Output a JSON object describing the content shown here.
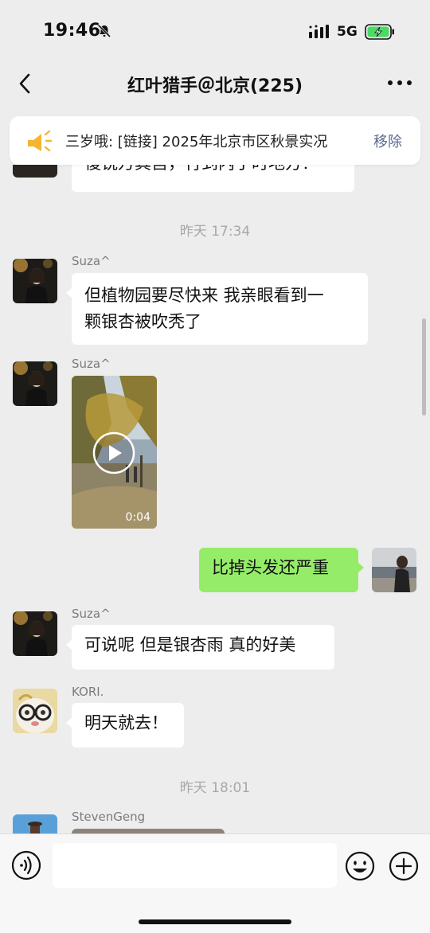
{
  "status_bar": {
    "time": "19:46",
    "network": "5G"
  },
  "nav": {
    "title": "红叶猎手＠北京(225)"
  },
  "pinned": {
    "text": "三岁哦: [链接] 2025年北京市区秋景实况",
    "remove_label": "移除"
  },
  "chat": {
    "partial_message": "復锐万其宫，行到内于时地方？",
    "timestamp_1": "昨天 17:34",
    "messages": [
      {
        "sender": "Suza^",
        "lines": [
          "但植物园要尽快来 我亲眼看到一",
          "颗银杏被吹秃了"
        ]
      },
      {
        "sender": "Suza^",
        "video_duration": "0:04"
      },
      {
        "self": true,
        "text": "比掉头发还严重"
      },
      {
        "sender": "Suza^",
        "text": "可说呢 但是银杏雨 真的好美"
      },
      {
        "sender": "KORI.",
        "text": "明天就去！"
      }
    ],
    "timestamp_2": "昨天 18:01",
    "last_sender": "StevenGeng"
  },
  "icons": {
    "bell": "bell-slash-icon",
    "signal": "signal-icon",
    "battery": "battery-charging-icon",
    "back": "chevron-left-icon",
    "more": "more-dots-icon",
    "pin": "speaker-icon",
    "voice": "voice-icon",
    "emoji": "emoji-icon",
    "plus": "plus-icon",
    "play": "play-icon"
  },
  "colors": {
    "background": "#ededed",
    "green_bubble": "#95ec69",
    "link": "#5a6b91",
    "battery": "#4cd964"
  }
}
